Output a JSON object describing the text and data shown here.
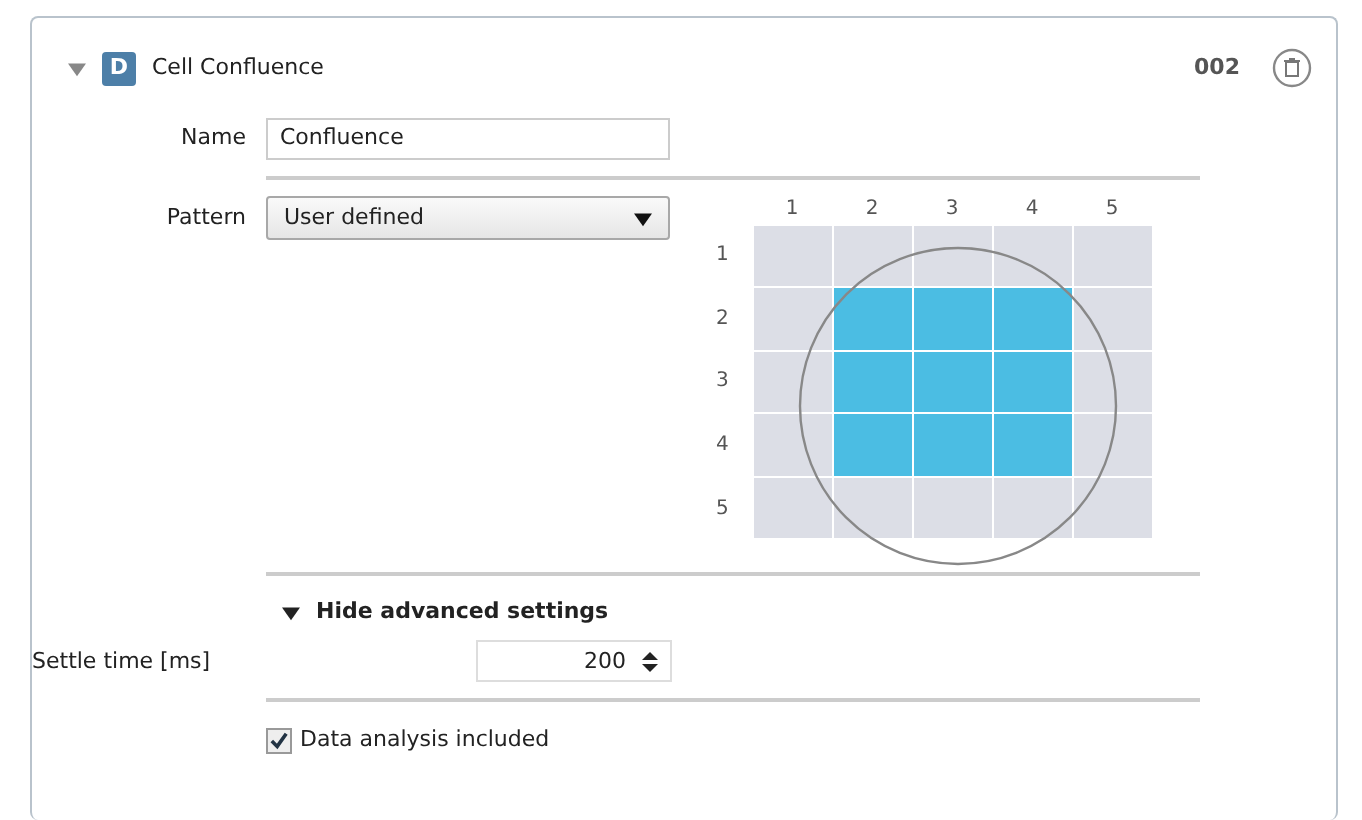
{
  "header": {
    "expanded": true,
    "badge": "D",
    "title": "Cell Confluence",
    "number": "002"
  },
  "name": {
    "label": "Name",
    "value": "Confluence"
  },
  "pattern": {
    "label": "Pattern",
    "value": "User defined"
  },
  "grid": {
    "columns": [
      "1",
      "2",
      "3",
      "4",
      "5"
    ],
    "rows": [
      "1",
      "2",
      "3",
      "4",
      "5"
    ],
    "cells": [
      [
        false,
        false,
        false,
        false,
        false
      ],
      [
        false,
        true,
        true,
        true,
        false
      ],
      [
        false,
        true,
        true,
        true,
        false
      ],
      [
        false,
        true,
        true,
        true,
        false
      ],
      [
        false,
        false,
        false,
        false,
        false
      ]
    ]
  },
  "advanced": {
    "label": "Hide advanced settings",
    "expanded": true
  },
  "settle": {
    "label": "Settle time [ms]",
    "value": "200"
  },
  "analysis": {
    "label": "Data analysis included",
    "checked": true
  }
}
